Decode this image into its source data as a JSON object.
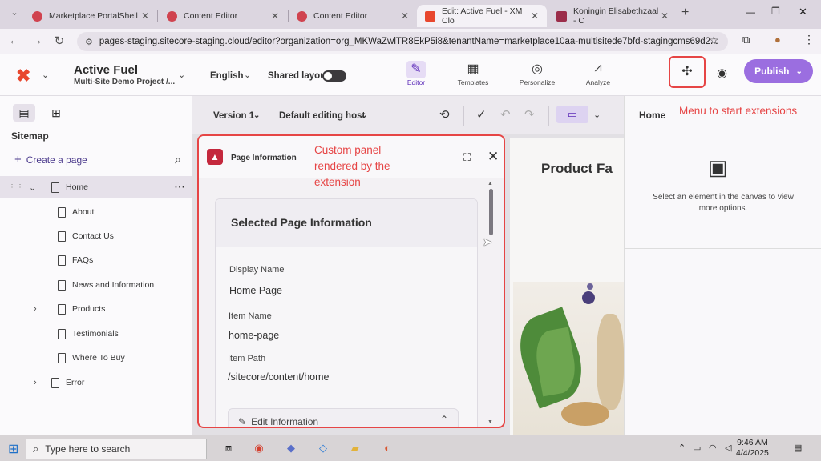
{
  "browser": {
    "tabs": [
      {
        "label": "Marketplace PortalShell"
      },
      {
        "label": "Content Editor"
      },
      {
        "label": "Content Editor"
      },
      {
        "label": "Edit: Active Fuel - XM Clo"
      },
      {
        "label": "Koningin Elisabethzaal - C"
      }
    ],
    "new_tab": "+",
    "url": "pages-staging.sitecore-staging.cloud/editor?organization=org_MKWaZwlTR8EkP5i8&tenantName=marketplace10aa-multisitede7bfd-stagingcms69d2..."
  },
  "header": {
    "site_name": "Active Fuel",
    "site_sub": "Multi-Site Demo Project /...",
    "language": "English",
    "shared_layout": "Shared layout",
    "nav": [
      "Editor",
      "Templates",
      "Personalize",
      "Analyze"
    ],
    "publish": "Publish"
  },
  "sidebar": {
    "title": "Sitemap",
    "create": "Create a page",
    "tree": [
      {
        "label": "Home"
      },
      {
        "label": "About"
      },
      {
        "label": "Contact Us"
      },
      {
        "label": "FAQs"
      },
      {
        "label": "News and Information"
      },
      {
        "label": "Products"
      },
      {
        "label": "Testimonials"
      },
      {
        "label": "Where To Buy"
      },
      {
        "label": "Error"
      }
    ]
  },
  "canvas_toolbar": {
    "version": "Version 1",
    "host": "Default editing host"
  },
  "canvas": {
    "product_title": "Product Fa"
  },
  "panel": {
    "title": "Page Information",
    "card_title": "Selected Page Information",
    "fields": [
      {
        "label": "Display Name",
        "value": "Home Page"
      },
      {
        "label": "Item Name",
        "value": "home-page"
      },
      {
        "label": "Item Path",
        "value": "/sitecore/content/home"
      }
    ],
    "edit_section": "Edit Information"
  },
  "right_panel": {
    "tab": "Home",
    "message": "Select an element in the canvas to view more options."
  },
  "annotations": {
    "extension_panel": "Custom panel rendered by the extension",
    "extension_menu": "Menu to start extensions"
  },
  "taskbar": {
    "search_placeholder": "Type here to search",
    "time": "9:46 AM",
    "date": "4/4/2025"
  }
}
